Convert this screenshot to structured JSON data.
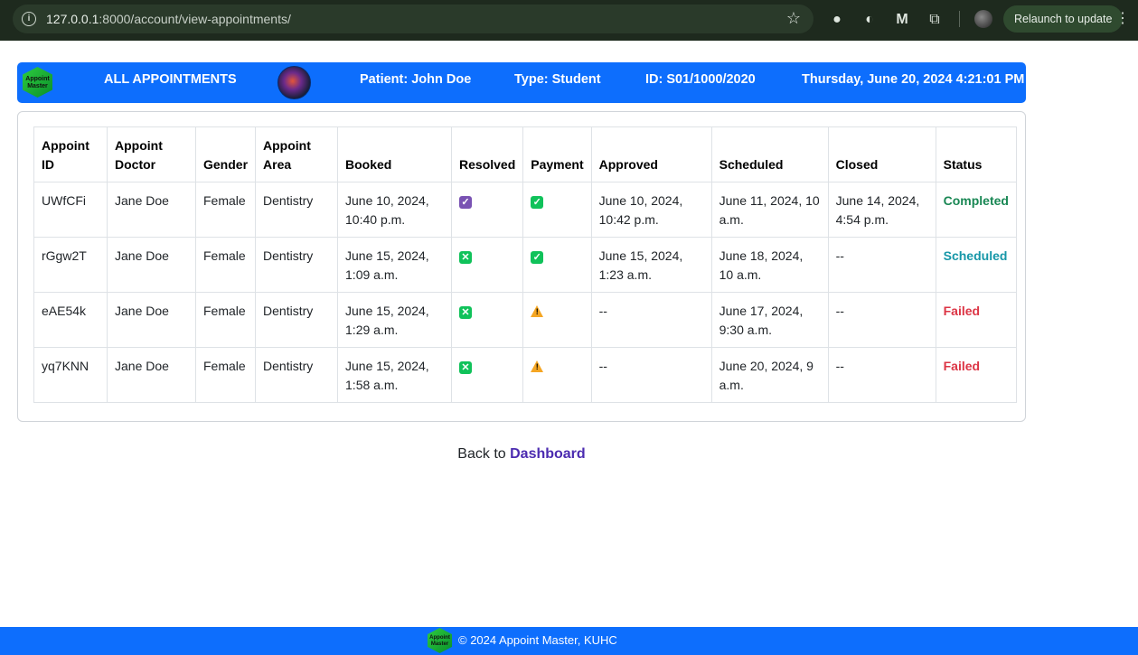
{
  "browser": {
    "url_host": "127.0.0.1",
    "url_rest": ":8000/account/view-appointments/",
    "relaunch_label": "Relaunch to update"
  },
  "header": {
    "logo_text": "Appoint Master",
    "title": "ALL APPOINTMENTS",
    "patient": "Patient: John Doe",
    "type": "Type: Student",
    "id": "ID: S01/1000/2020",
    "datetime": "Thursday, June 20, 2024 4:21:01 PM"
  },
  "table": {
    "headers": {
      "id": "Appoint ID",
      "doctor": "Appoint Doctor",
      "gender": "Gender",
      "area": "Appoint Area",
      "booked": "Booked",
      "resolved": "Resolved",
      "payment": "Payment",
      "approved": "Approved",
      "scheduled": "Scheduled",
      "closed": "Closed",
      "status": "Status"
    },
    "rows": [
      {
        "id": "UWfCFi",
        "doctor": "Jane Doe",
        "gender": "Female",
        "area": "Dentistry",
        "booked": "June 10, 2024, 10:40 p.m.",
        "resolved": "check-purple",
        "payment": "check-green",
        "approved": "June 10, 2024, 10:42 p.m.",
        "scheduled": "June 11, 2024, 10 a.m.",
        "closed": "June 14, 2024, 4:54 p.m.",
        "status": "Completed"
      },
      {
        "id": "rGgw2T",
        "doctor": "Jane Doe",
        "gender": "Female",
        "area": "Dentistry",
        "booked": "June 15, 2024, 1:09 a.m.",
        "resolved": "cross-green",
        "payment": "check-green",
        "approved": "June 15, 2024, 1:23 a.m.",
        "scheduled": "June 18, 2024, 10 a.m.",
        "closed": "--",
        "status": "Scheduled"
      },
      {
        "id": "eAE54k",
        "doctor": "Jane Doe",
        "gender": "Female",
        "area": "Dentistry",
        "booked": "June 15, 2024, 1:29 a.m.",
        "resolved": "cross-green",
        "payment": "warning",
        "approved": "--",
        "scheduled": "June 17, 2024, 9:30 a.m.",
        "closed": "--",
        "status": "Failed"
      },
      {
        "id": "yq7KNN",
        "doctor": "Jane Doe",
        "gender": "Female",
        "area": "Dentistry",
        "booked": "June 15, 2024, 1:58 a.m.",
        "resolved": "cross-green",
        "payment": "warning",
        "approved": "--",
        "scheduled": "June 20, 2024, 9 a.m.",
        "closed": "--",
        "status": "Failed"
      }
    ]
  },
  "back": {
    "prefix": "Back to",
    "link": "Dashboard"
  },
  "footer": {
    "logo_text": "Appoint Master",
    "text": "© 2024 Appoint Master, KUHC"
  },
  "colors": {
    "primary": "#0d6efd",
    "completed": "#198754",
    "scheduled": "#1797a8",
    "failed": "#dc3545"
  }
}
